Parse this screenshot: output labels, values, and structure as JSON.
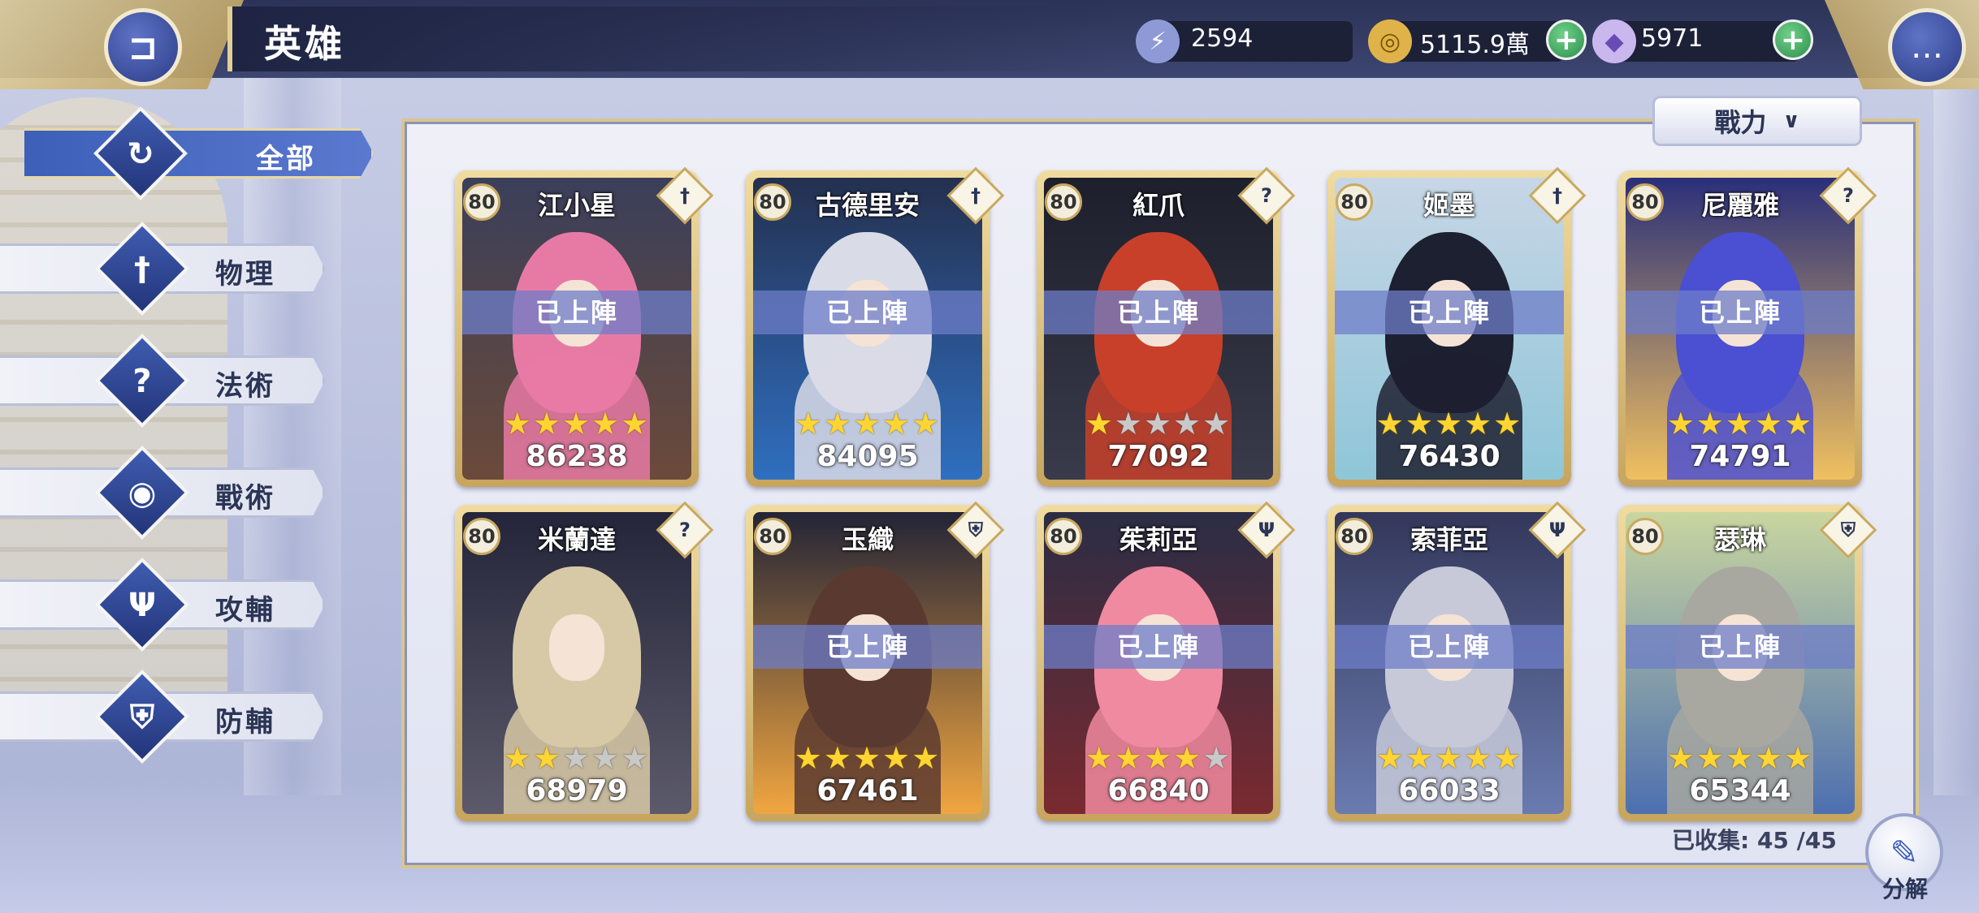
{
  "header": {
    "title": "英雄",
    "back_icon": "back-icon",
    "chat_icon": "chat-icon"
  },
  "resources": {
    "stamina": {
      "icon": "stamina-icon",
      "value": "2594"
    },
    "gold": {
      "icon": "gold-coin-icon",
      "value": "5115.9萬"
    },
    "gems": {
      "icon": "diamond-icon",
      "value": "5971"
    }
  },
  "sidebar": {
    "items": [
      {
        "label": "全部",
        "icon": "all-icon",
        "active": true
      },
      {
        "label": "物理",
        "icon": "sword-icon",
        "active": false
      },
      {
        "label": "法術",
        "icon": "magic-icon",
        "active": false
      },
      {
        "label": "戰術",
        "icon": "tactic-icon",
        "active": false
      },
      {
        "label": "攻輔",
        "icon": "attack-support-icon",
        "active": false
      },
      {
        "label": "防輔",
        "icon": "shield-icon",
        "active": false
      }
    ]
  },
  "sort": {
    "label": "戰力"
  },
  "heroes": [
    {
      "name": "江小星",
      "level": "80",
      "status": "已上陣",
      "stars": 5,
      "power": "86238",
      "class_icon": "sword-icon"
    },
    {
      "name": "古德里安",
      "level": "80",
      "status": "已上陣",
      "stars": 5,
      "power": "84095",
      "class_icon": "sword-icon"
    },
    {
      "name": "紅爪",
      "level": "80",
      "status": "已上陣",
      "stars": 1,
      "power": "77092",
      "class_icon": "magic-icon"
    },
    {
      "name": "姬墨",
      "level": "80",
      "status": "已上陣",
      "stars": 5,
      "power": "76430",
      "class_icon": "sword-icon"
    },
    {
      "name": "尼麗雅",
      "level": "80",
      "status": "已上陣",
      "stars": 5,
      "power": "74791",
      "class_icon": "magic-icon"
    },
    {
      "name": "米蘭達",
      "level": "80",
      "status": "",
      "stars": 2,
      "power": "68979",
      "class_icon": "magic-icon"
    },
    {
      "name": "玉織",
      "level": "80",
      "status": "已上陣",
      "stars": 5,
      "power": "67461",
      "class_icon": "shield-icon"
    },
    {
      "name": "茱莉亞",
      "level": "80",
      "status": "已上陣",
      "stars": 4,
      "power": "66840",
      "class_icon": "attack-support-icon"
    },
    {
      "name": "索菲亞",
      "level": "80",
      "status": "已上陣",
      "stars": 5,
      "power": "66033",
      "class_icon": "attack-support-icon"
    },
    {
      "name": "瑟琳",
      "level": "80",
      "status": "已上陣",
      "stars": 5,
      "power": "65344",
      "class_icon": "shield-icon"
    }
  ],
  "footer": {
    "collected": "已收集: 45 /45",
    "decompose_label": "分解"
  },
  "colors": {
    "accent": "#3d5fb8",
    "gold_frame": "#d9c68e",
    "star": "#ffd531"
  }
}
